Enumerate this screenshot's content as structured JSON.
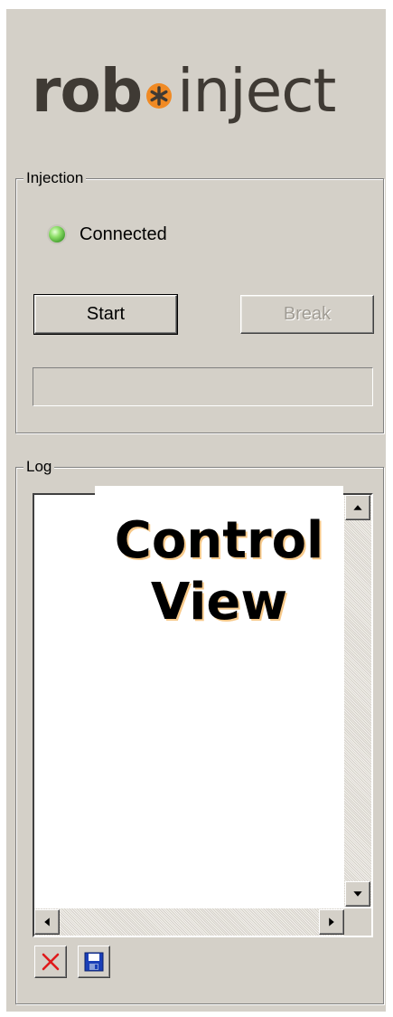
{
  "logo": {
    "bold_text": "rob",
    "light_text": "inject",
    "mark_icon": "orange-asterisk-icon",
    "mark_color": "#f08a24"
  },
  "injection": {
    "group_title": "Injection",
    "status_label": "Connected",
    "status_led_color": "#5ccf3a",
    "start_label": "Start",
    "break_label": "Break",
    "break_enabled": false,
    "progress_fraction": 0
  },
  "log": {
    "group_title": "Log",
    "content": "",
    "overlay_line1": "Control",
    "overlay_line2": "View",
    "clear_icon": "red-x-icon",
    "save_icon": "floppy-disk-icon"
  },
  "colors": {
    "panel_bg": "#d4d0c8",
    "logo_text": "#3f3a34",
    "clear_red": "#e0191b",
    "save_blue": "#1a3fb8"
  }
}
